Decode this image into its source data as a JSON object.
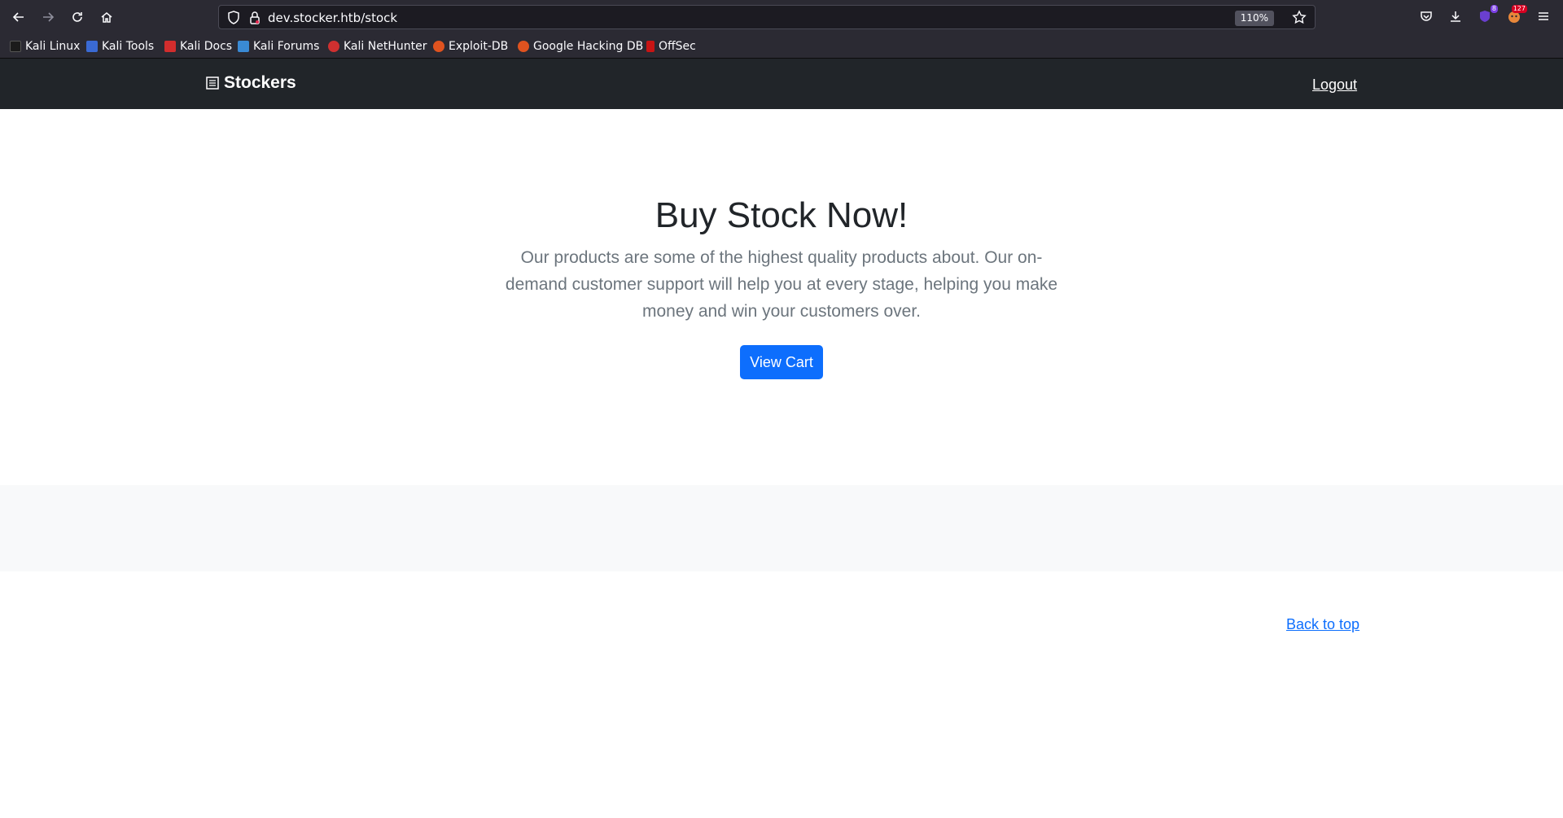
{
  "browser": {
    "url": "dev.stocker.htb/stock",
    "zoom": "110%",
    "extensions": [
      {
        "name": "ublock-icon",
        "badge": "8",
        "badge_color": "#7b3fe4"
      },
      {
        "name": "foxyproxy-icon",
        "badge": "127",
        "badge_color": "#d70022"
      }
    ],
    "bookmarks": [
      {
        "label": "Kali Linux",
        "color": "#1b1b1b"
      },
      {
        "label": "Kali Tools",
        "color": "#3a6ad4"
      },
      {
        "label": "Kali Docs",
        "color": "#d22d2d"
      },
      {
        "label": "Kali Forums",
        "color": "#3a8ad4"
      },
      {
        "label": "Kali NetHunter",
        "color": "#d03030"
      },
      {
        "label": "Exploit-DB",
        "color": "#e0531f"
      },
      {
        "label": "Google Hacking DB",
        "color": "#e0531f"
      },
      {
        "label": "OffSec",
        "color": "#c81414"
      }
    ]
  },
  "site": {
    "brand": "Stockers",
    "logout": "Logout",
    "hero_title": "Buy Stock Now!",
    "hero_text": "Our products are some of the highest quality products about. Our on-demand customer support will help you at every stage, helping you make money and win your customers over.",
    "view_cart": "View Cart",
    "back_to_top": "Back to top"
  },
  "colors": {
    "navbar_bg": "#212529",
    "primary": "#0d6efd",
    "muted_text": "#6c757d"
  }
}
